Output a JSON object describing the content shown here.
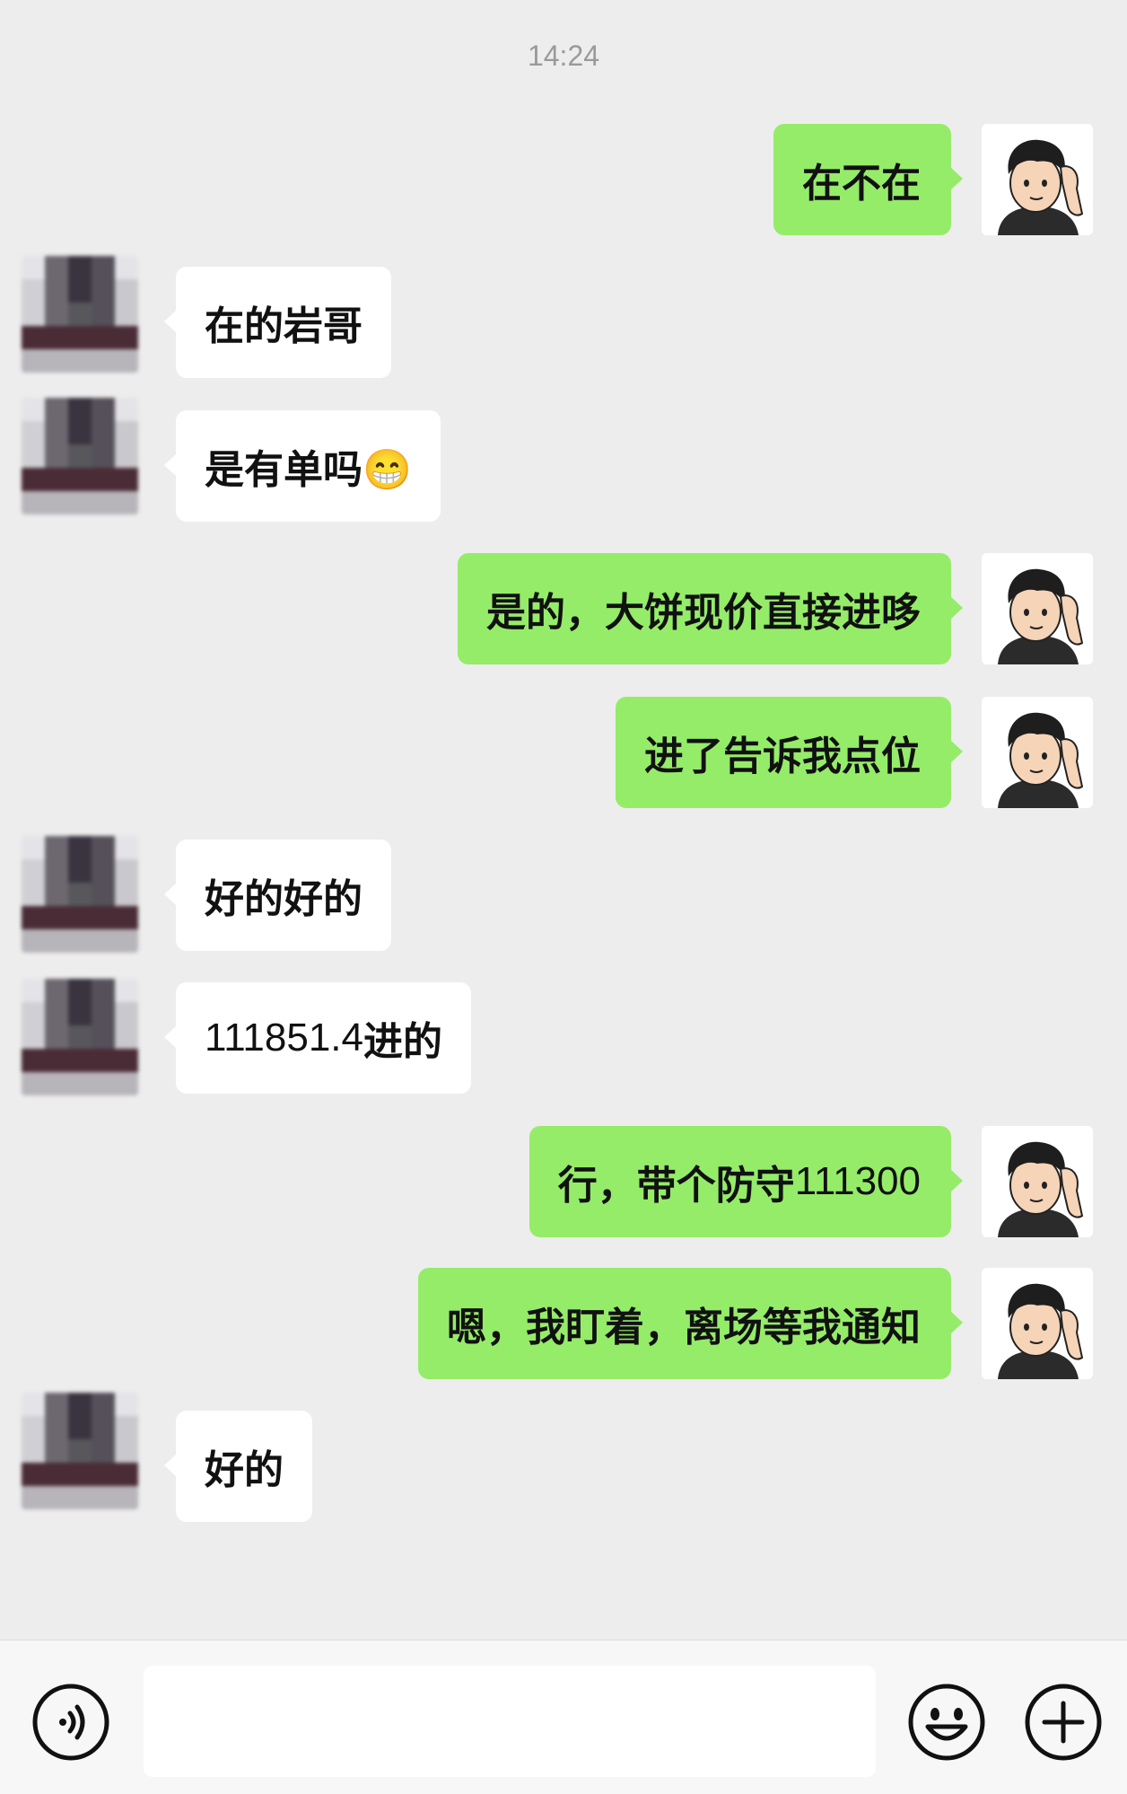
{
  "timestamp": "14:24",
  "messages": [
    {
      "side": "out",
      "text": "在不在"
    },
    {
      "side": "in",
      "text": "在的岩哥"
    },
    {
      "side": "in",
      "text": "是有单吗😁"
    },
    {
      "side": "out",
      "text": "是的，大饼现价直接进哆"
    },
    {
      "side": "out",
      "text": "进了告诉我点位"
    },
    {
      "side": "in",
      "text": "好的好的"
    },
    {
      "side": "in",
      "text_number": "111851.4",
      "text_suffix": "进的"
    },
    {
      "side": "out",
      "text_prefix": "行，带个防守",
      "text_number": "111300"
    },
    {
      "side": "out",
      "text": "嗯，我盯着，离场等我通知"
    },
    {
      "side": "in",
      "text": "好的"
    }
  ],
  "input": {
    "value": "",
    "placeholder": ""
  },
  "icons": {
    "voice": "voice-icon",
    "emoji": "emoji-icon",
    "plus": "plus-icon"
  },
  "colors": {
    "background": "#ededed",
    "outgoing_bubble": "#95ec69",
    "incoming_bubble": "#ffffff"
  }
}
